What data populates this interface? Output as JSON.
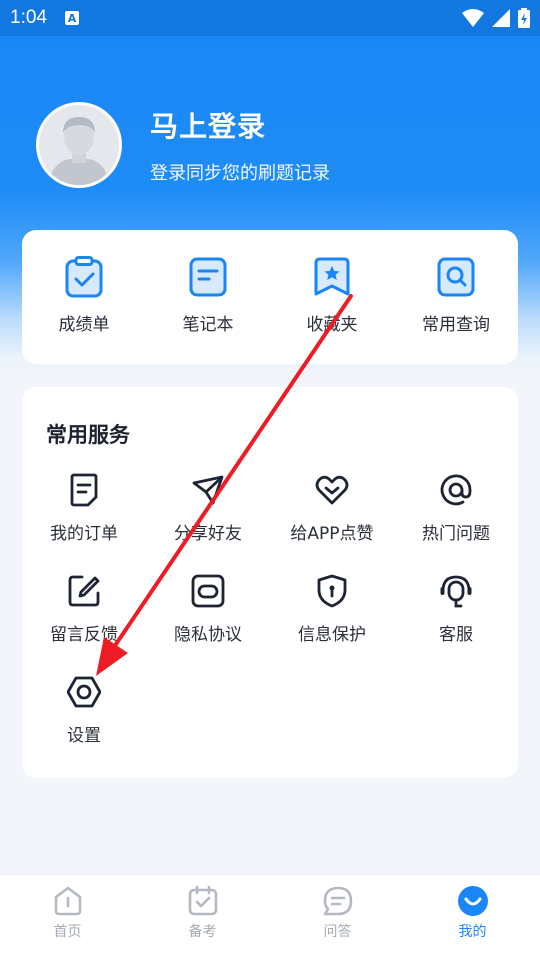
{
  "status": {
    "time": "1:04",
    "notif": "A"
  },
  "profile": {
    "title": "马上登录",
    "subtitle": "登录同步您的刷题记录"
  },
  "quick": [
    {
      "label": "成绩单",
      "icon": "clipboard-check-icon"
    },
    {
      "label": "笔记本",
      "icon": "notebook-icon"
    },
    {
      "label": "收藏夹",
      "icon": "bookmark-star-icon"
    },
    {
      "label": "常用查询",
      "icon": "search-doc-icon"
    }
  ],
  "services": {
    "title": "常用服务",
    "items": [
      {
        "label": "我的订单",
        "icon": "order-icon"
      },
      {
        "label": "分享好友",
        "icon": "paper-plane-icon"
      },
      {
        "label": "给APP点赞",
        "icon": "heart-like-icon"
      },
      {
        "label": "热门问题",
        "icon": "at-icon"
      },
      {
        "label": "留言反馈",
        "icon": "edit-icon"
      },
      {
        "label": "隐私协议",
        "icon": "privacy-icon"
      },
      {
        "label": "信息保护",
        "icon": "shield-icon"
      },
      {
        "label": "客服",
        "icon": "headset-icon"
      },
      {
        "label": "设置",
        "icon": "hexagon-settings-icon"
      }
    ]
  },
  "tabs": [
    {
      "label": "首页",
      "active": false
    },
    {
      "label": "备考",
      "active": false
    },
    {
      "label": "问答",
      "active": false
    },
    {
      "label": "我的",
      "active": true
    }
  ],
  "colors": {
    "primary": "#1a86f5",
    "annotation": "#ee1c24"
  }
}
